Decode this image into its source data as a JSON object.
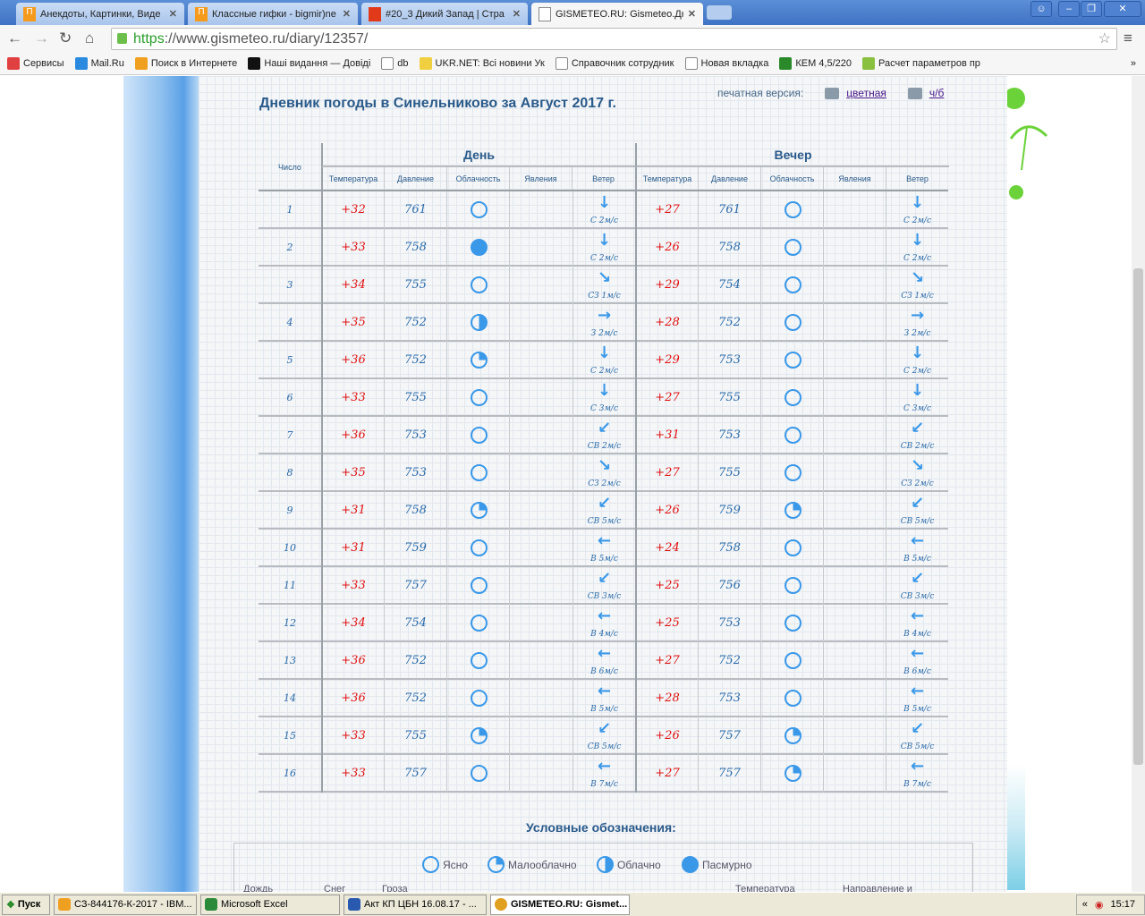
{
  "browser": {
    "tabs": [
      {
        "label": "Анекдоты, Картинки, Виде",
        "icon": "orange-p-icon"
      },
      {
        "label": "Классные гифки - bigmir)ne",
        "icon": "orange-p-icon"
      },
      {
        "label": "#20_3 Дикий Запад | Стра",
        "icon": "red-icon"
      },
      {
        "label": "GISMETEO.RU: Gismeteo.Дн",
        "icon": "page-icon",
        "active": true
      }
    ],
    "url_scheme": "https",
    "url_rest": "://www.gismeteo.ru/diary/12357/",
    "bookmarks": [
      "Сервисы",
      "Mail.Ru",
      "Поиск в Интернете",
      "Наші видання — Довіді",
      "db",
      "UKR.NET: Всі новини Ук",
      "Справочник сотрудник",
      "Новая вкладка",
      "КЕМ 4,5/220",
      "Расчет параметров пр"
    ],
    "more": "»"
  },
  "page": {
    "title": "Дневник погоды в Синельниково за Август 2017 г.",
    "print_label": "печатная версия:",
    "print_color": "цветная",
    "print_bw": "ч/б",
    "headers": {
      "day_col": "Число",
      "day": "День",
      "evening": "Вечер",
      "sub": [
        "Температура",
        "Давление",
        "Облачность",
        "Явления",
        "Ветер"
      ]
    },
    "rows": [
      {
        "d": "1",
        "dt": "+32",
        "dp": "761",
        "dc": "clear",
        "dw": "С 2м/с",
        "da": "S",
        "et": "+27",
        "ep": "761",
        "ec": "clear",
        "ew": "С 2м/с"
      },
      {
        "d": "2",
        "dt": "+33",
        "dp": "758",
        "dc": "overcast",
        "dw": "С 2м/с",
        "da": "S",
        "et": "+26",
        "ep": "758",
        "ec": "clear",
        "ew": "С 2м/с"
      },
      {
        "d": "3",
        "dt": "+34",
        "dp": "755",
        "dc": "clear",
        "dw": "СЗ 1м/с",
        "da": "SE",
        "et": "+29",
        "ep": "754",
        "ec": "clear",
        "ew": "СЗ 1м/с"
      },
      {
        "d": "4",
        "dt": "+35",
        "dp": "752",
        "dc": "cloudy",
        "dw": "З 2м/с",
        "da": "E",
        "et": "+28",
        "ep": "752",
        "ec": "clear",
        "ew": "З 2м/с"
      },
      {
        "d": "5",
        "dt": "+36",
        "dp": "752",
        "dc": "partly",
        "dw": "С 2м/с",
        "da": "S",
        "et": "+29",
        "ep": "753",
        "ec": "clear",
        "ew": "С 2м/с"
      },
      {
        "d": "6",
        "dt": "+33",
        "dp": "755",
        "dc": "clear",
        "dw": "С 3м/с",
        "da": "S",
        "et": "+27",
        "ep": "755",
        "ec": "clear",
        "ew": "С 3м/с"
      },
      {
        "d": "7",
        "dt": "+36",
        "dp": "753",
        "dc": "clear",
        "dw": "СВ 2м/с",
        "da": "SW",
        "et": "+31",
        "ep": "753",
        "ec": "clear",
        "ew": "СВ 2м/с"
      },
      {
        "d": "8",
        "dt": "+35",
        "dp": "753",
        "dc": "clear",
        "dw": "СЗ 2м/с",
        "da": "SE",
        "et": "+27",
        "ep": "755",
        "ec": "clear",
        "ew": "СЗ 2м/с"
      },
      {
        "d": "9",
        "dt": "+31",
        "dp": "758",
        "dc": "partly",
        "dw": "СВ 5м/с",
        "da": "SW",
        "et": "+26",
        "ep": "759",
        "ec": "partly",
        "ew": "СВ 5м/с"
      },
      {
        "d": "10",
        "dt": "+31",
        "dp": "759",
        "dc": "clear",
        "dw": "В 5м/с",
        "da": "W",
        "et": "+24",
        "ep": "758",
        "ec": "clear",
        "ew": "В 5м/с"
      },
      {
        "d": "11",
        "dt": "+33",
        "dp": "757",
        "dc": "clear",
        "dw": "СВ 3м/с",
        "da": "SW",
        "et": "+25",
        "ep": "756",
        "ec": "clear",
        "ew": "СВ 3м/с"
      },
      {
        "d": "12",
        "dt": "+34",
        "dp": "754",
        "dc": "clear",
        "dw": "В 4м/с",
        "da": "W",
        "et": "+25",
        "ep": "753",
        "ec": "clear",
        "ew": "В 4м/с"
      },
      {
        "d": "13",
        "dt": "+36",
        "dp": "752",
        "dc": "clear",
        "dw": "В 6м/с",
        "da": "W",
        "et": "+27",
        "ep": "752",
        "ec": "clear",
        "ew": "В 6м/с"
      },
      {
        "d": "14",
        "dt": "+36",
        "dp": "752",
        "dc": "clear",
        "dw": "В 5м/с",
        "da": "W",
        "et": "+28",
        "ep": "753",
        "ec": "clear",
        "ew": "В 5м/с"
      },
      {
        "d": "15",
        "dt": "+33",
        "dp": "755",
        "dc": "partly",
        "dw": "СВ 5м/с",
        "da": "SW",
        "et": "+26",
        "ep": "757",
        "ec": "partly",
        "ew": "СВ 5м/с"
      },
      {
        "d": "16",
        "dt": "+33",
        "dp": "757",
        "dc": "clear",
        "dw": "В 7м/с",
        "da": "W",
        "et": "+27",
        "ep": "757",
        "ec": "partly",
        "ew": "В 7м/с"
      }
    ],
    "legend_title": "Условные обозначения:",
    "legend": [
      {
        "label": "Ясно",
        "type": "clear"
      },
      {
        "label": "Малооблачно",
        "type": "partly"
      },
      {
        "label": "Облачно",
        "type": "cloudy"
      },
      {
        "label": "Пасмурно",
        "type": "overcast"
      }
    ],
    "legend_row2": [
      "Дождь",
      "Снег",
      "Гроза",
      "Температура",
      "Направление и"
    ]
  },
  "taskbar": {
    "start": "Пуск",
    "tasks": [
      "СЗ-844176-К-2017 - IBM...",
      "Microsoft Excel",
      "Акт КП ЦБН 16.08.17 - ...",
      "GISMETEO.RU: Gismet..."
    ],
    "clock": "15:17"
  },
  "colors": {
    "accent": "#3a98e8",
    "temp": "#e01010",
    "title": "#2a5a8a"
  }
}
